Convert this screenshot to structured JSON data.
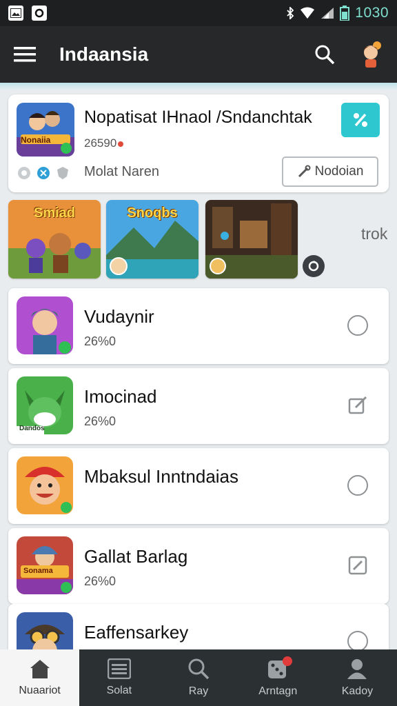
{
  "status_bar": {
    "time": "1030",
    "icons": [
      "image-icon",
      "circle-notification-icon",
      "bluetooth-icon",
      "wifi-icon",
      "signal-icon",
      "battery-icon"
    ]
  },
  "app_bar": {
    "title": "Indaansia",
    "icons": [
      "menu-icon",
      "search-icon",
      "profile-character-icon"
    ]
  },
  "featured": {
    "thumb_text": "Nonaiia",
    "title": "Nopatisat IHnaol /Sndanchtak",
    "count": "26590",
    "subtitle": "Molat Naren",
    "action_label": "Nodoian",
    "action_icon": "wrench-icon",
    "top_action_icon": "percent-icon"
  },
  "carousel": {
    "tiles": [
      {
        "text": "Smiad"
      },
      {
        "text": "Snoqbs"
      },
      {
        "text": ""
      }
    ],
    "side_label": "trok",
    "next_icon": "refresh-icon"
  },
  "apps": [
    {
      "name": "Vudaynir",
      "size": "26%0",
      "action": "circle"
    },
    {
      "name": "Imocinad",
      "size": "26%0",
      "action": "edit"
    },
    {
      "name": "Mbaksul Inntndaias",
      "size": "",
      "action": "circle"
    },
    {
      "name": "Gallat Barlag",
      "size": "26%0",
      "action": "edit"
    },
    {
      "name": "Eaffensarkey",
      "size": "",
      "action": "circle"
    }
  ],
  "icon_labels": {
    "badge_1": "Dandos",
    "badge_4": "Sonama"
  },
  "bottom_nav": [
    {
      "label": "Nuaariot",
      "icon": "home-icon",
      "active": true
    },
    {
      "label": "Solat",
      "icon": "list-icon",
      "active": false
    },
    {
      "label": "Ray",
      "icon": "search-icon",
      "active": false
    },
    {
      "label": "Arntagn",
      "icon": "dice-icon",
      "active": false
    },
    {
      "label": "Kadoy",
      "icon": "person-icon",
      "active": false
    }
  ],
  "colors": {
    "teal": "#2ec7cf",
    "appbar": "#262829",
    "nav": "#2b3133",
    "time": "#7fe0cf"
  }
}
